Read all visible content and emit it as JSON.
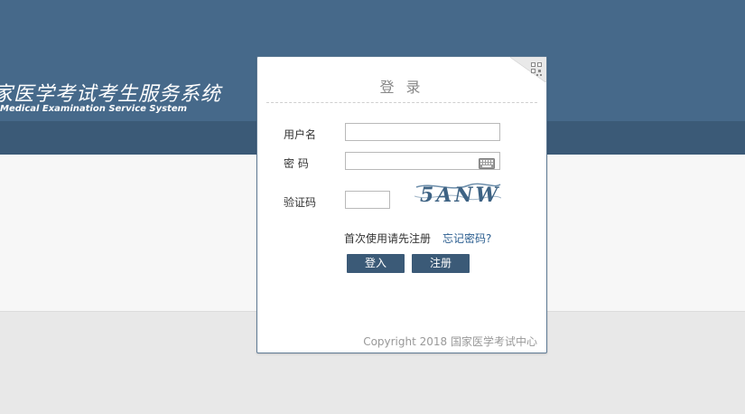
{
  "header": {
    "title_cn": "家医学考试考生服务系统",
    "title_en": "Medical Examination Service System"
  },
  "login": {
    "title": "登 录",
    "username_label": "用户名",
    "password_label": "密 码",
    "captcha_label": "验证码",
    "captcha_text": "5ANW",
    "username_value": "",
    "password_value": "",
    "captcha_value": "",
    "register_hint": "首次使用请先注册",
    "forgot_link": "忘记密码?",
    "login_button": "登入",
    "register_button": "注册",
    "copyright": "Copyright 2018 国家医学考试中心"
  },
  "colors": {
    "header": "#46698a",
    "header_strip": "#3b5a77",
    "button": "#3b5a77",
    "link": "#2a5d8f"
  },
  "icons": [
    "qr-code-icon",
    "keyboard-icon"
  ]
}
